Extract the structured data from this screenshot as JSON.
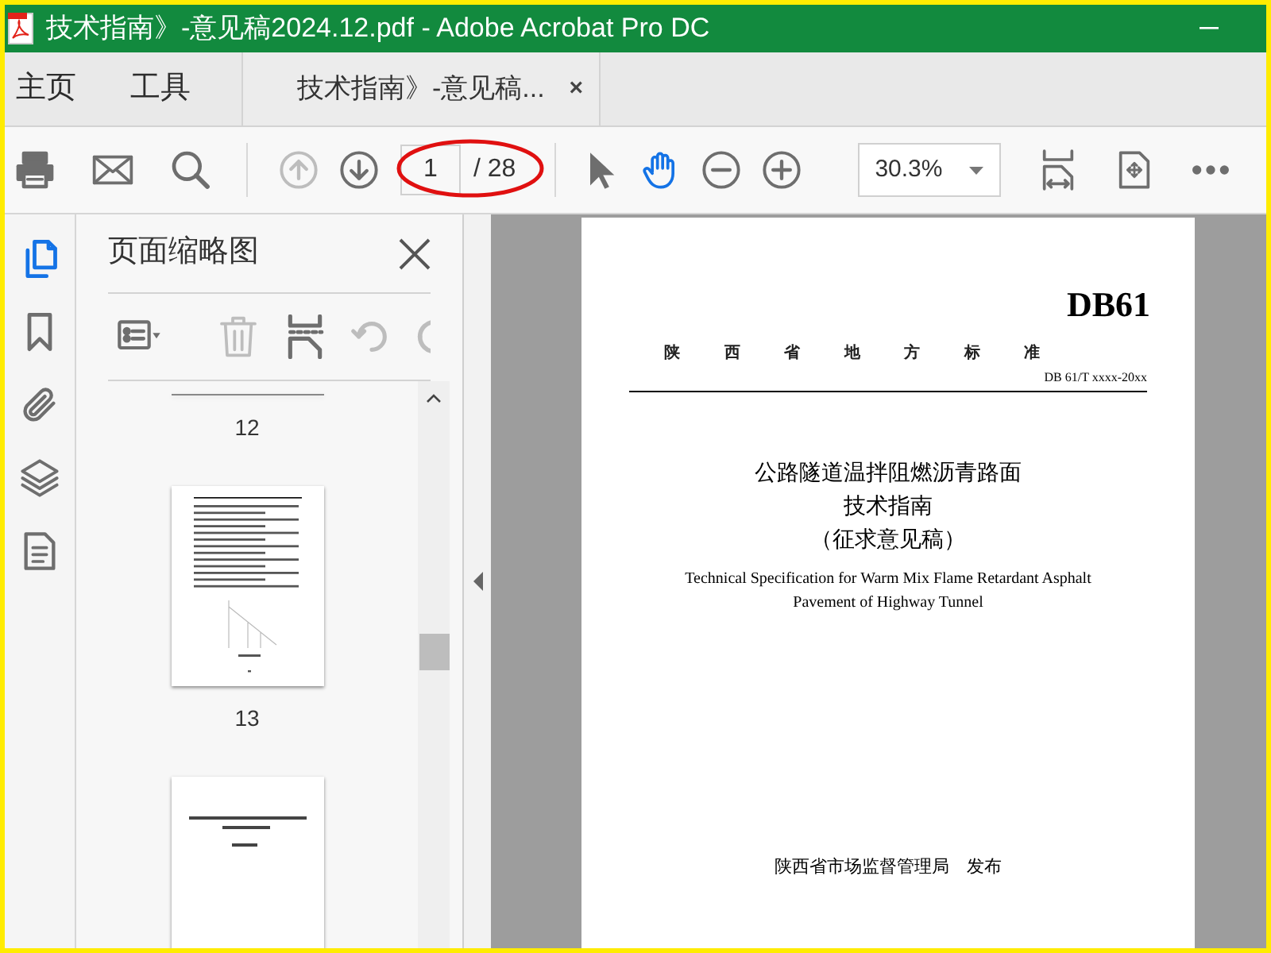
{
  "window": {
    "title": "技术指南》-意见稿2024.12.pdf - Adobe Acrobat Pro DC"
  },
  "nav_tabs": [
    {
      "label": "主页",
      "selected": false
    },
    {
      "label": "工具",
      "selected": false
    }
  ],
  "document_tabs": [
    {
      "label": "技术指南》-意见稿...",
      "selected": true,
      "close": "×"
    }
  ],
  "toolbar": {
    "left_tools": [
      {
        "kind": "print",
        "disabled": false
      },
      {
        "kind": "mail",
        "disabled": false
      },
      {
        "kind": "search",
        "disabled": false
      }
    ],
    "nav_tools": [
      {
        "kind": "prev",
        "disabled": true
      },
      {
        "kind": "next",
        "disabled": false
      }
    ],
    "page_number": "1",
    "page_count": "/ 28",
    "mode_tools": [
      {
        "kind": "select",
        "selected": false
      },
      {
        "kind": "hand",
        "selected": true
      },
      {
        "kind": "zoom_out",
        "selected": false
      },
      {
        "kind": "zoom_in",
        "selected": false
      }
    ],
    "zoom": "30.3%",
    "right_tools": [
      {
        "kind": "fit"
      },
      {
        "kind": "scan"
      },
      {
        "kind": "more"
      }
    ]
  },
  "side_rail": [
    {
      "kind": "pages",
      "selected": true
    },
    {
      "kind": "bookmark",
      "selected": false
    },
    {
      "kind": "attachment",
      "selected": false
    },
    {
      "kind": "layers",
      "selected": false
    },
    {
      "kind": "document",
      "selected": false
    }
  ],
  "thumbnail_panel": {
    "title": "页面缩略图",
    "tools": [
      {
        "kind": "options",
        "disabled": false
      },
      {
        "kind": "delete",
        "disabled": true
      },
      {
        "kind": "insert",
        "disabled": false
      },
      {
        "kind": "undo",
        "disabled": true
      },
      {
        "kind": "redo",
        "disabled": true
      }
    ],
    "thumbnails": [
      {
        "kind": "cut",
        "label": "12"
      },
      {
        "kind": "text",
        "label": "13"
      },
      {
        "kind": "cover"
      }
    ]
  },
  "document": {
    "code": "DB61",
    "category": "陕 西 省 地 方 标 准",
    "number": "DB 61/T xxxx-20xx",
    "title_lines": [
      "公路隧道温拌阻燃沥青路面",
      "技术指南",
      "（征求意见稿）"
    ],
    "english_lines": [
      "Technical Specification for Warm Mix Flame Retardant Asphalt",
      "Pavement of Highway Tunnel"
    ],
    "issuer": "陕西省市场监督管理局　发布"
  }
}
